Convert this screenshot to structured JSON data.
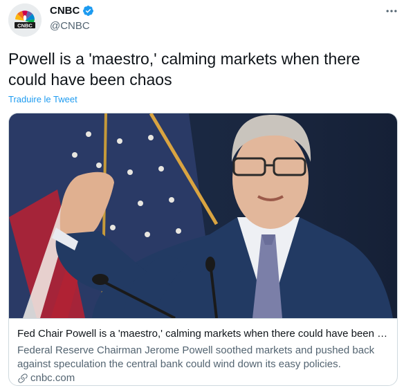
{
  "author": {
    "name": "CNBC",
    "handle": "@CNBC",
    "logo_text": "CNBC",
    "verified_color": "#1d9bf0"
  },
  "tweet": {
    "text": "Powell is a 'maestro,' calming markets when there could have been chaos",
    "translate_label": "Traduire le Tweet"
  },
  "card": {
    "title": "Fed Chair Powell is a 'maestro,' calming markets when there could have been chaos",
    "description": "Federal Reserve Chairman Jerome Powell soothed markets and pushed back against speculation the central bank could wind down its easy policies.",
    "domain": "cnbc.com"
  },
  "icons": {
    "more": "more-horizontal-icon",
    "verified": "verified-badge-icon",
    "link": "link-icon"
  },
  "colors": {
    "accent": "#1d9bf0",
    "secondary_text": "#536471",
    "border": "#cfd9de"
  }
}
